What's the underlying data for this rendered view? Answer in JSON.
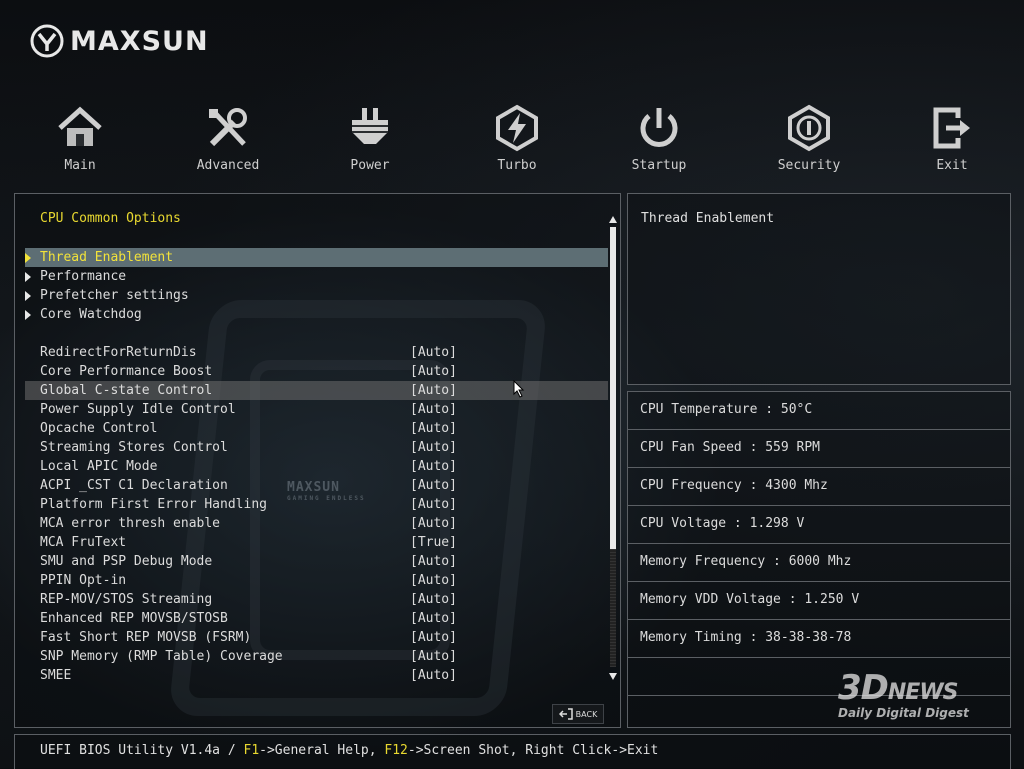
{
  "brand": {
    "name": "MAXSUN"
  },
  "nav": [
    {
      "id": "main",
      "label": "Main",
      "icon": "home-icon"
    },
    {
      "id": "advanced",
      "label": "Advanced",
      "icon": "tools-icon"
    },
    {
      "id": "power",
      "label": "Power",
      "icon": "power-plug-icon"
    },
    {
      "id": "turbo",
      "label": "Turbo",
      "icon": "lightning-icon"
    },
    {
      "id": "startup",
      "label": "Startup",
      "icon": "power-button-icon"
    },
    {
      "id": "security",
      "label": "Security",
      "icon": "shield-icon"
    },
    {
      "id": "exit",
      "label": "Exit",
      "icon": "exit-icon"
    }
  ],
  "left": {
    "section_title": "CPU Common Options",
    "submenus": [
      "Thread Enablement",
      "Performance",
      "Prefetcher settings",
      "Core Watchdog"
    ],
    "settings": [
      {
        "name": "RedirectForReturnDis",
        "value": "[Auto]"
      },
      {
        "name": "Core Performance Boost",
        "value": "[Auto]"
      },
      {
        "name": "Global C-state Control",
        "value": "[Auto]"
      },
      {
        "name": "Power Supply Idle Control",
        "value": "[Auto]"
      },
      {
        "name": "Opcache Control",
        "value": "[Auto]"
      },
      {
        "name": "Streaming Stores Control",
        "value": "[Auto]"
      },
      {
        "name": "Local APIC Mode",
        "value": "[Auto]"
      },
      {
        "name": "ACPI _CST C1 Declaration",
        "value": "[Auto]"
      },
      {
        "name": "Platform First Error Handling",
        "value": "[Auto]"
      },
      {
        "name": "MCA error thresh enable",
        "value": "[Auto]"
      },
      {
        "name": "MCA FruText",
        "value": "[True]"
      },
      {
        "name": "SMU and PSP Debug Mode",
        "value": "[Auto]"
      },
      {
        "name": "PPIN Opt-in",
        "value": "[Auto]"
      },
      {
        "name": "REP-MOV/STOS Streaming",
        "value": "[Auto]"
      },
      {
        "name": "Enhanced REP MOVSB/STOSB",
        "value": "[Auto]"
      },
      {
        "name": "Fast Short REP MOVSB (FSRM)",
        "value": "[Auto]"
      },
      {
        "name": "SNP Memory (RMP Table) Coverage",
        "value": "[Auto]"
      },
      {
        "name": "SMEE",
        "value": "[Auto]"
      }
    ],
    "back_label": "BACK",
    "watermark_brand": "MAXSUN",
    "watermark_sub": "GAMING ENDLESS"
  },
  "help": {
    "title": "Thread Enablement"
  },
  "info": [
    "CPU Temperature : 50°C",
    "CPU Fan Speed : 559 RPM",
    "CPU Frequency : 4300 Mhz",
    "CPU Voltage : 1.298 V",
    "Memory Frequency : 6000 Mhz",
    "Memory VDD Voltage : 1.250 V",
    "Memory Timing : 38-38-38-78"
  ],
  "status": {
    "prefix": "UEFI BIOS Utility V1.4a / ",
    "f1_key": "F1",
    "f1_text": "->General Help, ",
    "f12_key": "F12",
    "f12_text": "->Screen Shot, Right Click->Exit"
  },
  "overlay_watermark": {
    "big": "3D",
    "news": "NEWS",
    "tagline": "Daily Digital Digest"
  },
  "colors": {
    "accent_yellow": "#e8d830",
    "selected_bg": "#5d6e74",
    "border": "#5b5f64"
  }
}
